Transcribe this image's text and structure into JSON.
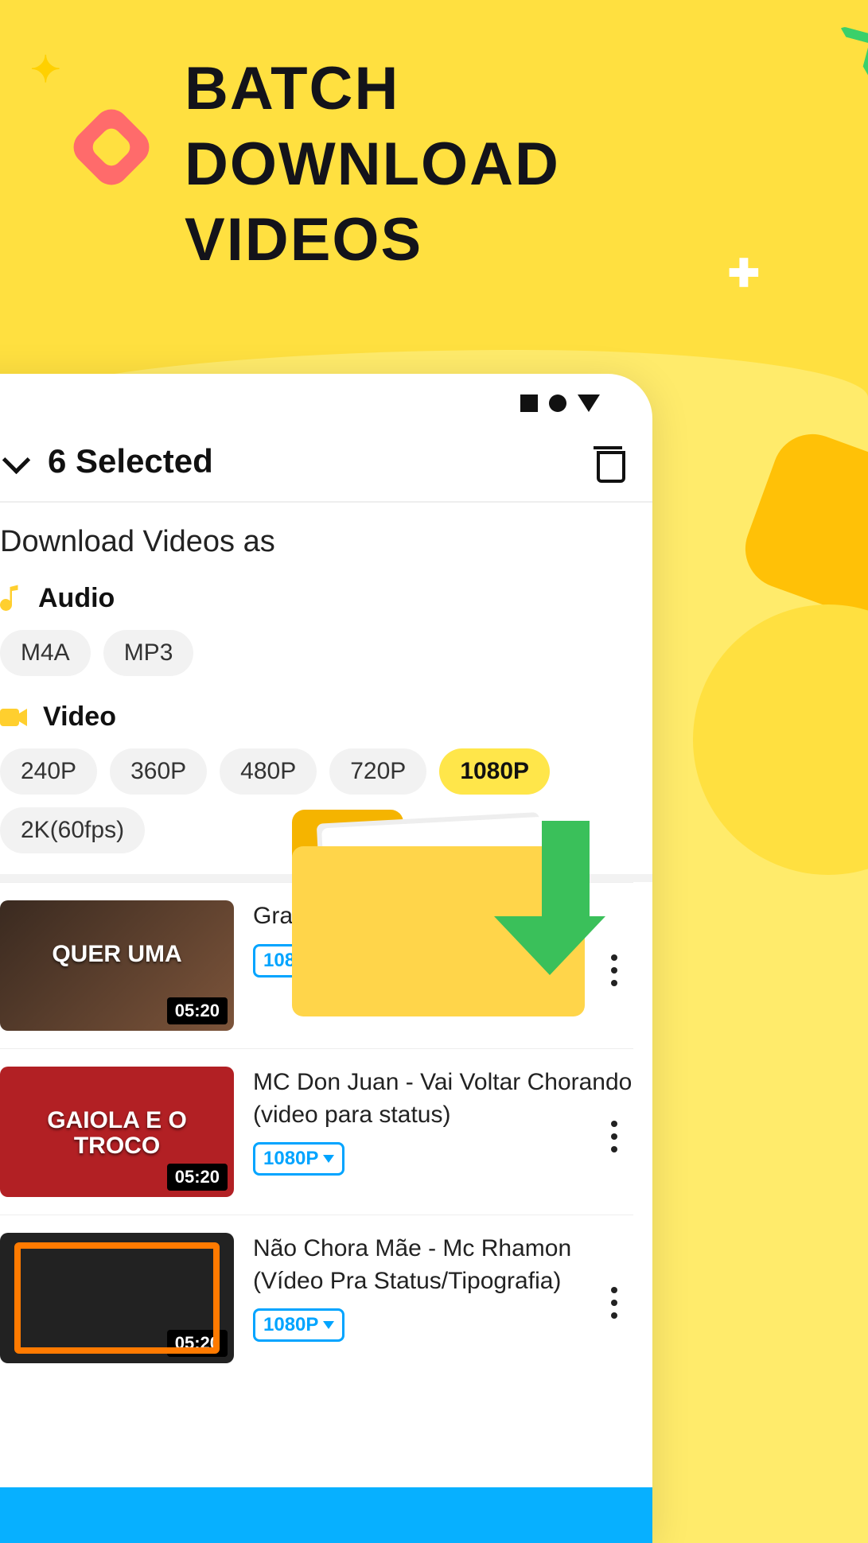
{
  "headline": "BATCH\nDOWNLOAD\nVIDEOS",
  "header": {
    "selected_text": "6 Selected"
  },
  "section_title": "Download Videos as",
  "categories": {
    "audio_label": "Audio",
    "audio_formats": [
      "M4A",
      "MP3"
    ],
    "video_label": "Video",
    "video_formats": [
      "240P",
      "360P",
      "480P",
      "720P",
      "1080P",
      "2K(60fps)"
    ],
    "video_selected": "1080P"
  },
  "videos": [
    {
      "title": "Gra                              sta",
      "thumb_overlay": "QUER UMA",
      "duration": "05:20",
      "quality": "1080P"
    },
    {
      "title": "MC Don Juan - Vai Voltar Chorando (video para status)",
      "thumb_overlay": "GAIOLA E O TROCO",
      "duration": "05:20",
      "quality": "1080P"
    },
    {
      "title": "Não Chora Mãe - Mc Rhamon (Vídeo Pra Status/Tipografia)",
      "thumb_overlay": "",
      "duration": "05:20",
      "quality": "1080P"
    }
  ]
}
